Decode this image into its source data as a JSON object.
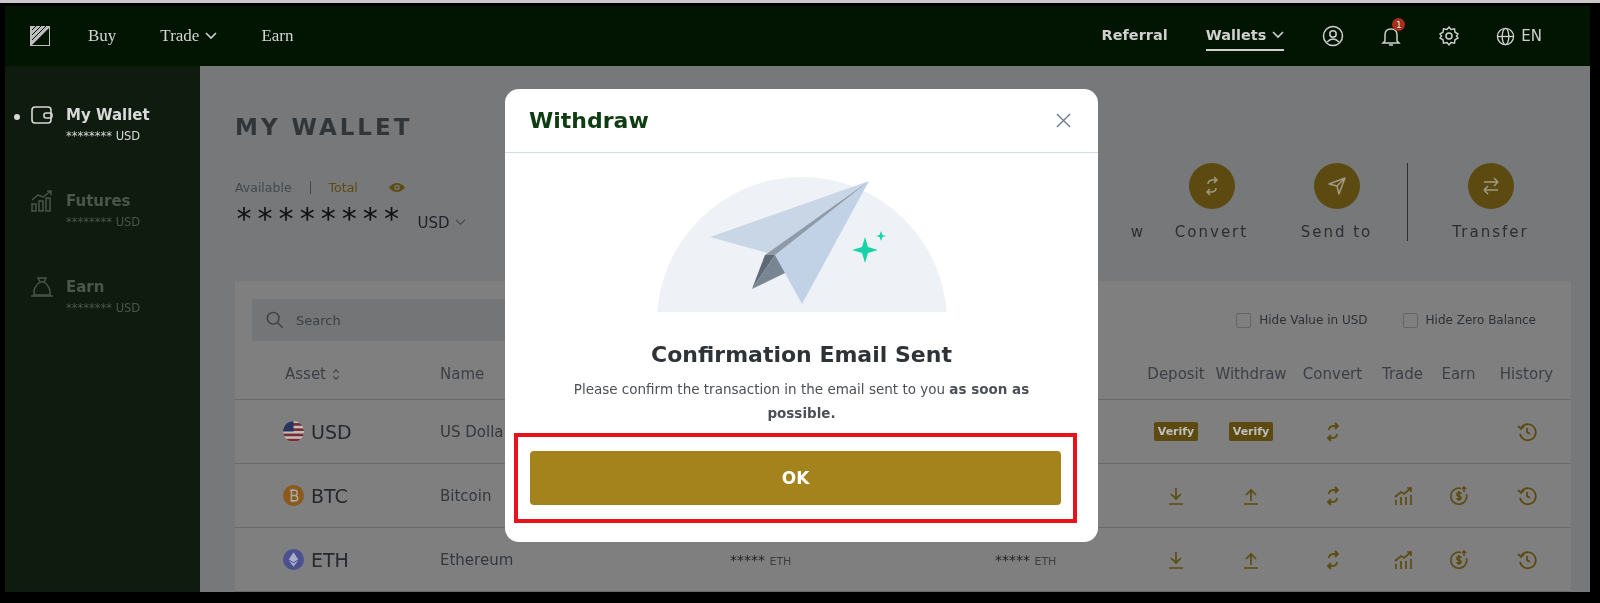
{
  "topbar": {
    "nav": [
      {
        "label": "Buy",
        "dropdown": false
      },
      {
        "label": "Trade",
        "dropdown": true
      },
      {
        "label": "Earn",
        "dropdown": false
      }
    ],
    "right_nav": [
      {
        "label": "Referral",
        "selected": false,
        "dropdown": false
      },
      {
        "label": "Wallets",
        "selected": true,
        "dropdown": true
      }
    ],
    "notification_count": "1",
    "language": "EN"
  },
  "sidebar": {
    "items": [
      {
        "label": "My Wallet",
        "amount": "******** USD",
        "selected": true
      },
      {
        "label": "Futures",
        "amount": "******** USD",
        "selected": false
      },
      {
        "label": "Earn",
        "amount": "******** USD",
        "selected": false
      }
    ]
  },
  "wallet": {
    "title": "MY WALLET",
    "balance_tabs": [
      {
        "label": "Available",
        "selected": false
      },
      {
        "label": "Total",
        "selected": true
      }
    ],
    "balance": "********",
    "currency": "USD",
    "actions": [
      {
        "label": "w",
        "kind": "label-only"
      },
      {
        "label": "Convert",
        "kind": "button"
      },
      {
        "label": "Send to",
        "kind": "button"
      },
      {
        "label": "Transfer",
        "kind": "button"
      }
    ]
  },
  "assets": {
    "search": {
      "placeholder": "Search"
    },
    "filters": [
      {
        "label": "Hide Value in USD",
        "checked": false
      },
      {
        "label": "Hide Zero Balance",
        "checked": false
      }
    ],
    "columns": [
      {
        "label": "Asset",
        "sortable": true
      },
      {
        "label": "Name",
        "sortable": false
      },
      {
        "label": "Deposit",
        "sortable": false
      },
      {
        "label": "Withdraw",
        "sortable": false
      },
      {
        "label": "Convert",
        "sortable": false
      },
      {
        "label": "Trade",
        "sortable": false
      },
      {
        "label": "Earn",
        "sortable": false
      },
      {
        "label": "History",
        "sortable": false
      }
    ],
    "rows": [
      {
        "asset": "USD",
        "name": "US Dolla",
        "actions": [
          {
            "kind": "verify",
            "label": "Verify"
          },
          {
            "kind": "verify",
            "label": "Verify"
          },
          {
            "kind": "convert"
          },
          {
            "kind": "none"
          },
          {
            "kind": "none"
          },
          {
            "kind": "history"
          }
        ]
      },
      {
        "asset": "BTC",
        "name": "Bitcoin",
        "actions": [
          {
            "kind": "deposit"
          },
          {
            "kind": "withdraw"
          },
          {
            "kind": "convert"
          },
          {
            "kind": "trade"
          },
          {
            "kind": "earn"
          },
          {
            "kind": "history"
          }
        ]
      },
      {
        "asset": "ETH",
        "name": "Ethereum",
        "column_3": {
          "value": "*****",
          "unit": "ETH"
        },
        "column_4": {
          "value": "*****",
          "unit": "ETH"
        },
        "actions": [
          {
            "kind": "deposit"
          },
          {
            "kind": "withdraw"
          },
          {
            "kind": "convert"
          },
          {
            "kind": "trade"
          },
          {
            "kind": "earn"
          },
          {
            "kind": "history"
          }
        ]
      }
    ]
  },
  "modal": {
    "title": "Withdraw",
    "heading": "Confirmation Email Sent",
    "message": "Please confirm the transaction in the email sent to you **as soon as possible.**",
    "button": "OK",
    "highlighted": true
  }
}
